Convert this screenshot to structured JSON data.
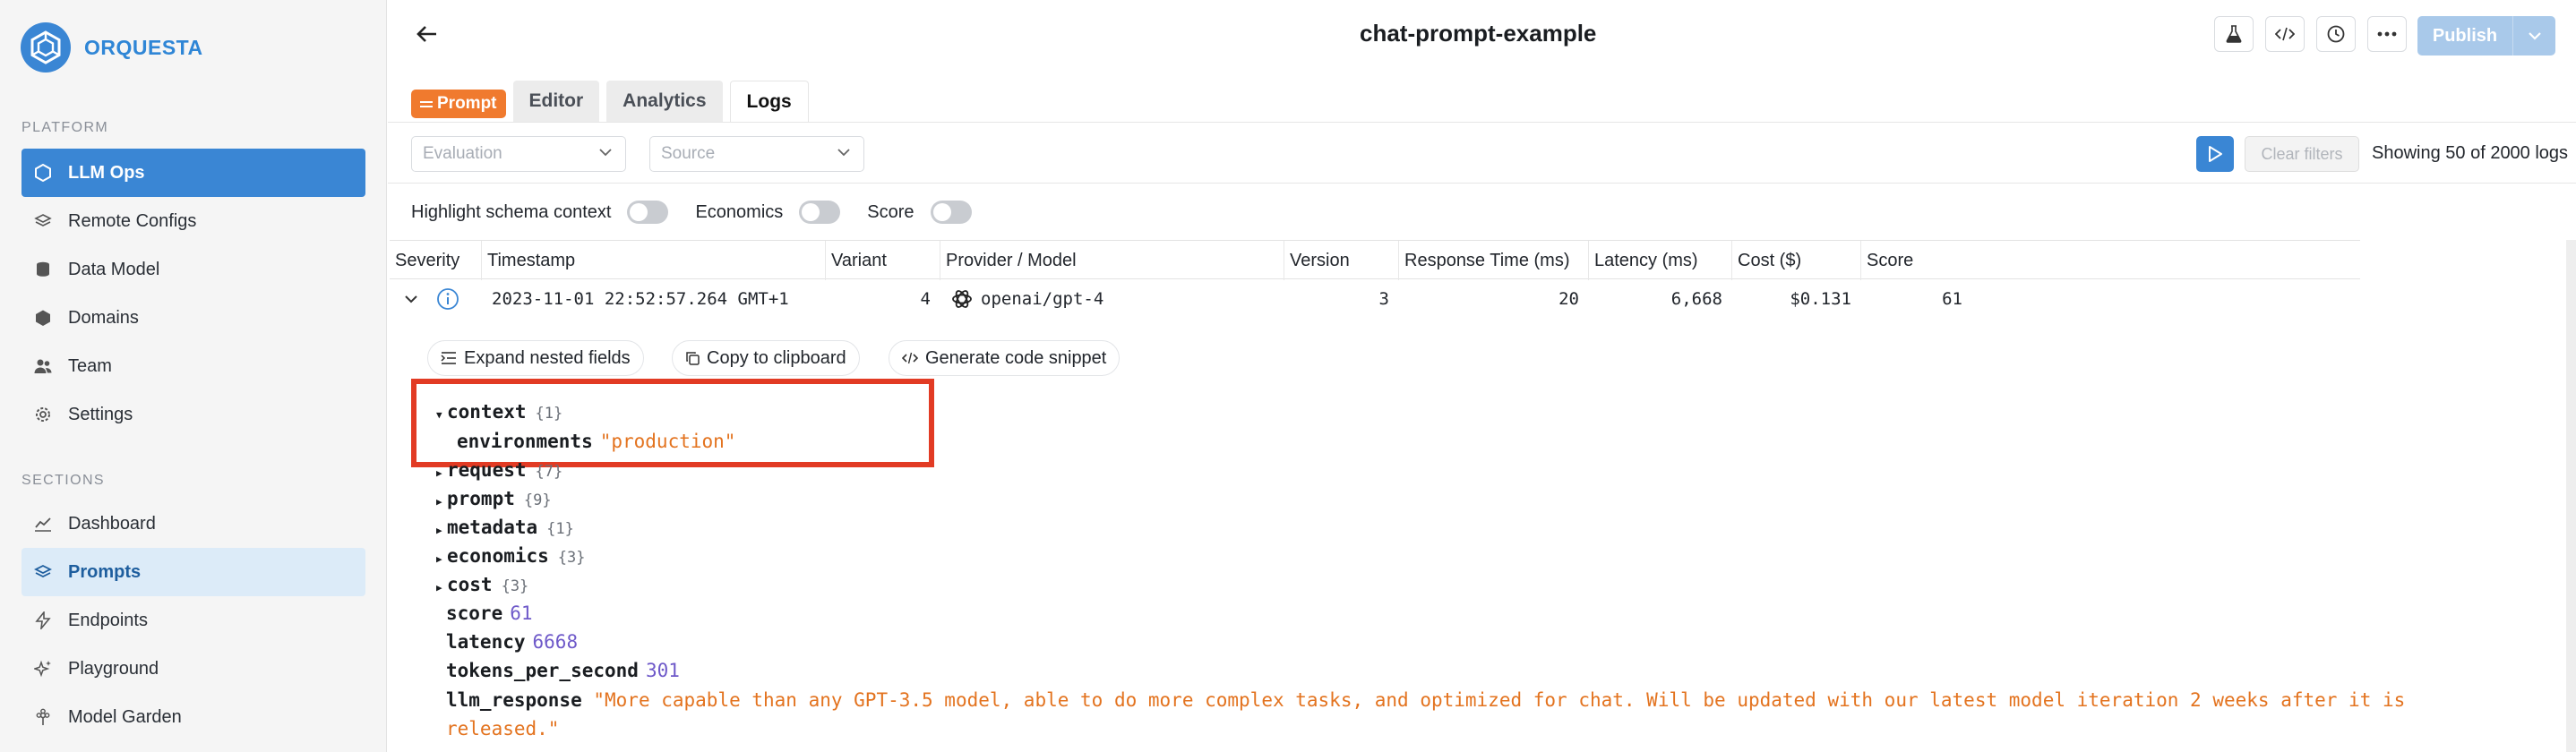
{
  "brand": {
    "name": "ORQUESTA",
    "color": "#2f86d6"
  },
  "sidebar": {
    "platform_label": "PLATFORM",
    "platform_items": [
      {
        "label": "LLM Ops",
        "icon": "hexagon-icon",
        "active": true
      },
      {
        "label": "Remote Configs",
        "icon": "layers-icon"
      },
      {
        "label": "Data Model",
        "icon": "database-icon"
      },
      {
        "label": "Domains",
        "icon": "cube-icon"
      },
      {
        "label": "Team",
        "icon": "users-icon"
      },
      {
        "label": "Settings",
        "icon": "gear-icon"
      }
    ],
    "sections_label": "SECTIONS",
    "section_items": [
      {
        "label": "Dashboard",
        "icon": "chart-line-icon"
      },
      {
        "label": "Prompts",
        "icon": "layers-icon",
        "active": true
      },
      {
        "label": "Endpoints",
        "icon": "bolt-icon"
      },
      {
        "label": "Playground",
        "icon": "sparkles-icon"
      },
      {
        "label": "Model Garden",
        "icon": "flower-icon"
      }
    ]
  },
  "header": {
    "title": "chat-prompt-example",
    "publish_label": "Publish",
    "tools": [
      "flask-icon",
      "code-icon",
      "clock-icon",
      "more-icon"
    ]
  },
  "tabs": {
    "badge": "Prompt",
    "items": [
      "Editor",
      "Analytics",
      "Logs"
    ],
    "active": "Logs"
  },
  "filters": {
    "evaluation_placeholder": "Evaluation",
    "source_placeholder": "Source",
    "clear_label": "Clear filters",
    "showing": "Showing 50 of 2000 logs"
  },
  "toggles": [
    {
      "label": "Highlight schema context",
      "on": false
    },
    {
      "label": "Economics",
      "on": false
    },
    {
      "label": "Score",
      "on": false
    }
  ],
  "table": {
    "columns": [
      "Severity",
      "Timestamp",
      "Variant",
      "Provider / Model",
      "Version",
      "Response Time (ms)",
      "Latency (ms)",
      "Cost ($)",
      "Score"
    ],
    "row": {
      "timestamp": "2023-11-01 22:52:57.264 GMT+1",
      "variant": "4",
      "model": "openai/gpt-4",
      "version": "3",
      "response_time": "20",
      "latency": "6,668",
      "cost": "$0.131",
      "score": "61"
    }
  },
  "actions": {
    "expand": "Expand nested fields",
    "copy": "Copy to clipboard",
    "snippet": "Generate code snippet"
  },
  "json_tree": {
    "context": {
      "key": "context",
      "count": "{1}"
    },
    "environments": {
      "key": "environments",
      "value": "\"production\""
    },
    "collapsed": [
      {
        "key": "request",
        "count": "{7}"
      },
      {
        "key": "prompt",
        "count": "{9}"
      },
      {
        "key": "metadata",
        "count": "{1}"
      },
      {
        "key": "economics",
        "count": "{3}"
      },
      {
        "key": "cost",
        "count": "{3}"
      }
    ],
    "score": {
      "key": "score",
      "value": "61"
    },
    "latency": {
      "key": "latency",
      "value": "6668"
    },
    "tps": {
      "key": "tokens_per_second",
      "value": "301"
    },
    "llm": {
      "key": "llm_response",
      "value": "\"More capable than any GPT-3.5 model, able to do more complex tasks, and optimized for chat. Will be updated with our latest model iteration 2 weeks after it is released.\""
    }
  },
  "colors": {
    "accent": "#3a86d4",
    "prompt_badge": "#f07a2e",
    "highlight": "#e23b24",
    "string": "#e3731f",
    "number": "#6e59c9"
  }
}
